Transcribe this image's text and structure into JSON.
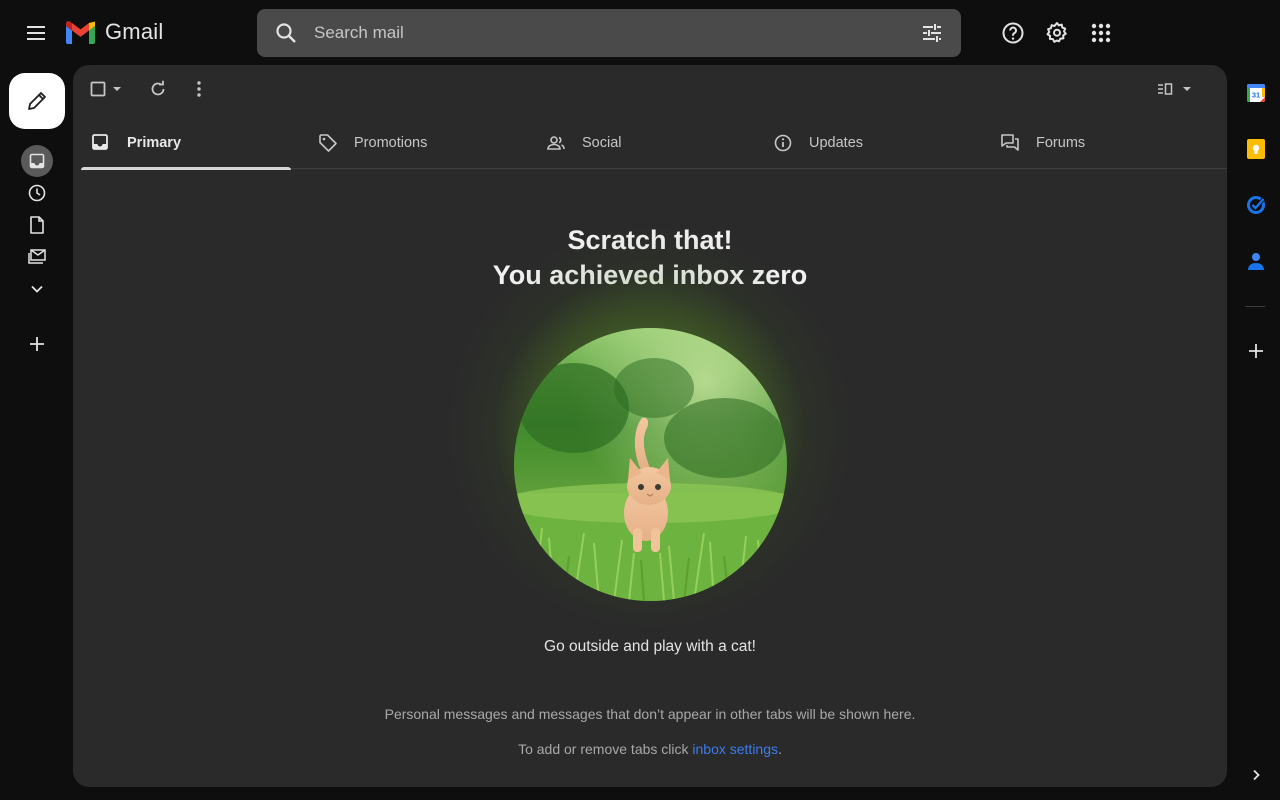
{
  "app": {
    "logo_text": "Gmail"
  },
  "search": {
    "placeholder": "Search mail"
  },
  "icons": {
    "menu": "menu-icon",
    "search": "search-icon",
    "tune": "tune-icon",
    "help": "help-icon",
    "settings": "gear-icon",
    "apps": "apps-grid-icon",
    "compose": "pencil-icon"
  },
  "left_rail": {
    "items": [
      {
        "name": "inbox",
        "icon": "inbox-icon",
        "active": true
      },
      {
        "name": "snoozed",
        "icon": "clock-icon"
      },
      {
        "name": "drafts",
        "icon": "file-icon"
      },
      {
        "name": "all-mail",
        "icon": "mail-stack-icon"
      },
      {
        "name": "more",
        "icon": "chevron-down-icon"
      }
    ],
    "add_icon": "plus-icon"
  },
  "tabs": [
    {
      "label": "Primary",
      "icon": "inbox-icon",
      "active": true
    },
    {
      "label": "Promotions",
      "icon": "tag-icon"
    },
    {
      "label": "Social",
      "icon": "people-icon"
    },
    {
      "label": "Updates",
      "icon": "info-icon"
    },
    {
      "label": "Forums",
      "icon": "forum-icon"
    }
  ],
  "empty_state": {
    "title_line1": "Scratch that!",
    "title_line2": "You achieved inbox zero",
    "caption": "Go outside and play with a cat!",
    "info_line1": "Personal messages and messages that don’t appear in other tabs will be shown here.",
    "info_line2_prefix": "To add or remove tabs click ",
    "info_line2_link": "inbox settings",
    "info_line2_suffix": "."
  },
  "side_apps": [
    {
      "name": "calendar",
      "icon": "calendar-icon",
      "text": "31"
    },
    {
      "name": "keep",
      "icon": "keep-icon"
    },
    {
      "name": "tasks",
      "icon": "tasks-icon"
    },
    {
      "name": "contacts",
      "icon": "contacts-icon"
    }
  ],
  "colors": {
    "background": "#0e0e0e",
    "panel": "#2a2a2a",
    "search": "#4a4a4a",
    "link": "#3b7ded",
    "glow": "#78be28"
  }
}
